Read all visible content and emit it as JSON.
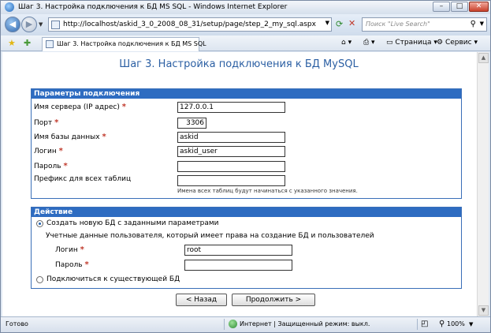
{
  "window": {
    "title": "Шаг 3. Настройка подключения к БД MS SQL - Windows Internet Explorer",
    "controls": {
      "minimize": "–",
      "maximize": "□",
      "close": "✕"
    }
  },
  "address_bar": {
    "url": "http://localhost/askid_3_0_2008_08_31/setup/page/step_2_my_sql.aspx",
    "search_placeholder": "Поиск \"Live Search\""
  },
  "tab": {
    "title": "Шаг 3. Настройка подключения к БД MS SQL"
  },
  "command_bar": {
    "page_label": "Страница",
    "tools_label": "Сервис"
  },
  "page": {
    "heading": "Шаг 3. Настройка подключения к БД MySQL",
    "connection": {
      "header": "Параметры подключения",
      "server_label": "Имя сервера (IP адрес)",
      "server_value": "127.0.0.1",
      "port_label": "Порт",
      "port_value": "3306",
      "db_label": "Имя базы данных",
      "db_value": "askid",
      "login_label": "Логин",
      "login_value": "askid_user",
      "password_label": "Пароль",
      "password_value": "",
      "prefix_label": "Префикс для всех таблиц",
      "prefix_value": "",
      "prefix_hint": "Имена всех таблиц будут начинаться с указанного значения."
    },
    "action": {
      "header": "Действие",
      "create_option": "Создать новую БД с заданными параметрами",
      "create_selected": true,
      "credentials_caption": "Учетные данные пользователя, который имеет права на создание БД и пользователей",
      "admin_login_label": "Логин",
      "admin_login_value": "root",
      "admin_password_label": "Пароль",
      "admin_password_value": "",
      "connect_option": "Подключиться к существующей БД"
    },
    "buttons": {
      "back": "< Назад",
      "next": "Продолжить >"
    },
    "required_mark": "*"
  },
  "status_bar": {
    "ready": "Готово",
    "zone": "Интернет | Защищенный режим: выкл.",
    "zoom": "100%"
  }
}
